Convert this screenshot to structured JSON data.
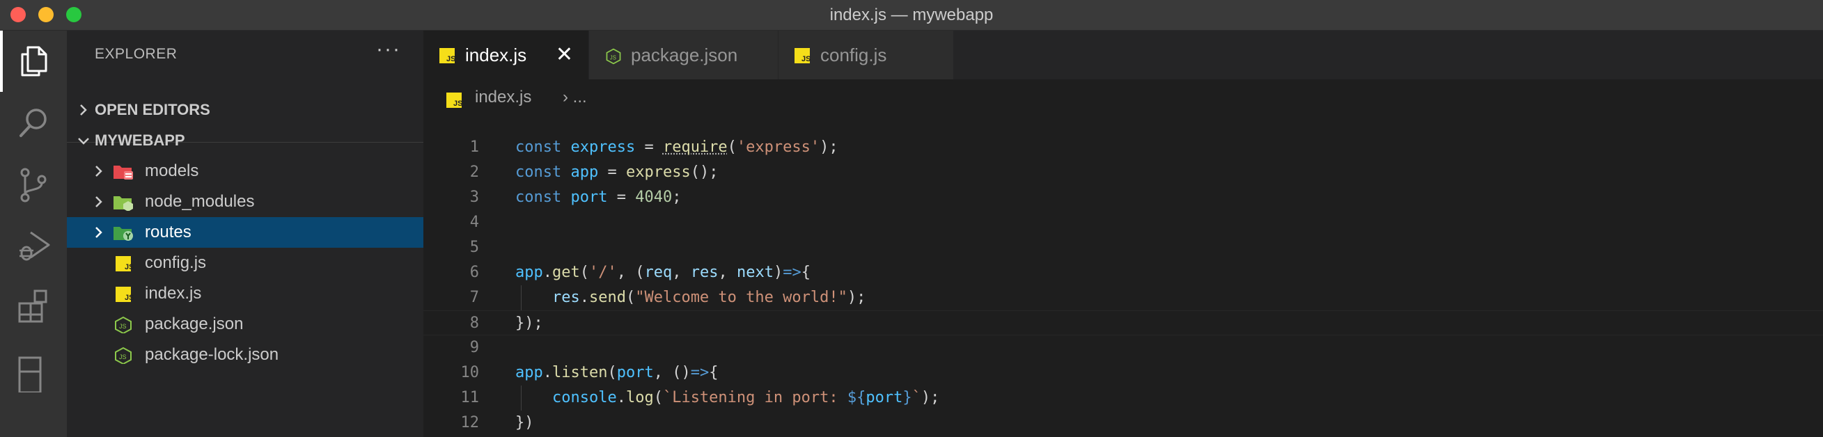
{
  "window": {
    "title": "index.js — mywebapp"
  },
  "activity_bar": {
    "items": [
      "explorer-icon",
      "search-icon",
      "source-control-icon",
      "run-debug-icon",
      "extensions-icon",
      "remote-icon"
    ]
  },
  "sidebar": {
    "header": "EXPLORER",
    "more_actions": "···",
    "open_editors_label": "OPEN EDITORS",
    "workspace_label": "MYWEBAPP",
    "tree": [
      {
        "label": "models",
        "kind": "folder",
        "icon": "folder-models-icon"
      },
      {
        "label": "node_modules",
        "kind": "folder",
        "icon": "folder-node-icon"
      },
      {
        "label": "routes",
        "kind": "folder",
        "icon": "folder-routes-icon",
        "selected": true
      },
      {
        "label": "config.js",
        "kind": "file",
        "icon": "js-file-icon"
      },
      {
        "label": "index.js",
        "kind": "file",
        "icon": "js-file-icon"
      },
      {
        "label": "package.json",
        "kind": "file",
        "icon": "node-json-icon"
      },
      {
        "label": "package-lock.json",
        "kind": "file",
        "icon": "node-json-icon"
      }
    ]
  },
  "tabs": [
    {
      "label": "index.js",
      "icon": "js-file-icon",
      "active": true,
      "close": "✕"
    },
    {
      "label": "package.json",
      "icon": "node-json-icon",
      "active": false
    },
    {
      "label": "config.js",
      "icon": "js-file-icon",
      "active": false
    }
  ],
  "breadcrumb": {
    "file": "index.js",
    "separator": "› ..."
  },
  "editor": {
    "current_line": 8,
    "lines": [
      {
        "n": "1",
        "tokens": [
          [
            "kw",
            "const"
          ],
          [
            "pun",
            " "
          ],
          [
            "var",
            "express"
          ],
          [
            "pun",
            " = "
          ],
          [
            "fn",
            "require",
            "squig"
          ],
          [
            "pun",
            "("
          ],
          [
            "str",
            "'express'"
          ],
          [
            "pun",
            ");"
          ]
        ]
      },
      {
        "n": "2",
        "tokens": [
          [
            "kw",
            "const"
          ],
          [
            "pun",
            " "
          ],
          [
            "var",
            "app"
          ],
          [
            "pun",
            " = "
          ],
          [
            "fn",
            "express"
          ],
          [
            "pun",
            "();"
          ]
        ]
      },
      {
        "n": "3",
        "tokens": [
          [
            "kw",
            "const"
          ],
          [
            "pun",
            " "
          ],
          [
            "var",
            "port"
          ],
          [
            "pun",
            " = "
          ],
          [
            "num",
            "4040"
          ],
          [
            "pun",
            ";"
          ]
        ]
      },
      {
        "n": "4",
        "tokens": []
      },
      {
        "n": "5",
        "tokens": []
      },
      {
        "n": "6",
        "tokens": [
          [
            "var",
            "app"
          ],
          [
            "pun",
            "."
          ],
          [
            "fn",
            "get"
          ],
          [
            "pun",
            "("
          ],
          [
            "str",
            "'/'"
          ],
          [
            "pun",
            ", ("
          ],
          [
            "prm",
            "req"
          ],
          [
            "pun",
            ", "
          ],
          [
            "prm",
            "res"
          ],
          [
            "pun",
            ", "
          ],
          [
            "prm",
            "next"
          ],
          [
            "pun",
            ")"
          ],
          [
            "kw",
            "=>"
          ],
          [
            "pun",
            "{"
          ]
        ]
      },
      {
        "n": "7",
        "tokens": [
          [
            "pun",
            "    "
          ],
          [
            "prm",
            "res"
          ],
          [
            "pun",
            "."
          ],
          [
            "fn",
            "send"
          ],
          [
            "pun",
            "("
          ],
          [
            "str",
            "\"Welcome to the world!\""
          ],
          [
            "pun",
            ");"
          ]
        ]
      },
      {
        "n": "8",
        "tokens": [
          [
            "pun",
            "});"
          ]
        ]
      },
      {
        "n": "9",
        "tokens": []
      },
      {
        "n": "10",
        "tokens": [
          [
            "var",
            "app"
          ],
          [
            "pun",
            "."
          ],
          [
            "fn",
            "listen"
          ],
          [
            "pun",
            "("
          ],
          [
            "var",
            "port"
          ],
          [
            "pun",
            ", ()"
          ],
          [
            "kw",
            "=>"
          ],
          [
            "pun",
            "{"
          ]
        ]
      },
      {
        "n": "11",
        "tokens": [
          [
            "pun",
            "    "
          ],
          [
            "var",
            "console"
          ],
          [
            "pun",
            "."
          ],
          [
            "fn",
            "log"
          ],
          [
            "pun",
            "("
          ],
          [
            "str",
            "`Listening in port: "
          ],
          [
            "kw",
            "${"
          ],
          [
            "var",
            "port"
          ],
          [
            "kw",
            "}"
          ],
          [
            "str",
            "`"
          ],
          [
            "pun",
            ");"
          ]
        ]
      },
      {
        "n": "12",
        "tokens": [
          [
            "pun",
            "})"
          ]
        ]
      }
    ]
  },
  "colors": {
    "selection": "#094771",
    "keyword": "#569cd6",
    "string": "#ce9178",
    "function": "#dcdcaa",
    "number": "#b5cea8",
    "variable": "#4fc1ff",
    "parameter": "#9cdcfe"
  }
}
